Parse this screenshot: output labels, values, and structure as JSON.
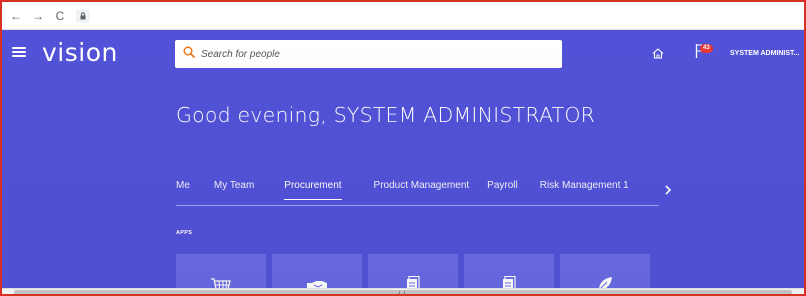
{
  "browser": {
    "back_glyph": "←",
    "forward_glyph": "→",
    "reload_glyph": "C",
    "lock_icon": "lock-icon"
  },
  "header": {
    "logo": "vision",
    "search_placeholder": "Search for people",
    "notification_count": "43",
    "user_label": "SYSTEM ADMINIST...",
    "accent_color": "#5252d8",
    "badge_color": "#e53935"
  },
  "greeting": "Good evening, SYSTEM ADMINISTRATOR",
  "tabs": [
    {
      "label": "Me"
    },
    {
      "label": "My Team"
    },
    {
      "label": "Procurement",
      "active": true
    },
    {
      "label": "Product Management"
    },
    {
      "label": "Payroll"
    },
    {
      "label": "Risk Management 1"
    }
  ],
  "apps_label": "APPS",
  "app_tiles": [
    {
      "icon": "cart-icon"
    },
    {
      "icon": "handshake-icon"
    },
    {
      "icon": "document-icon"
    },
    {
      "icon": "document-icon"
    },
    {
      "icon": "leaf-icon"
    }
  ]
}
